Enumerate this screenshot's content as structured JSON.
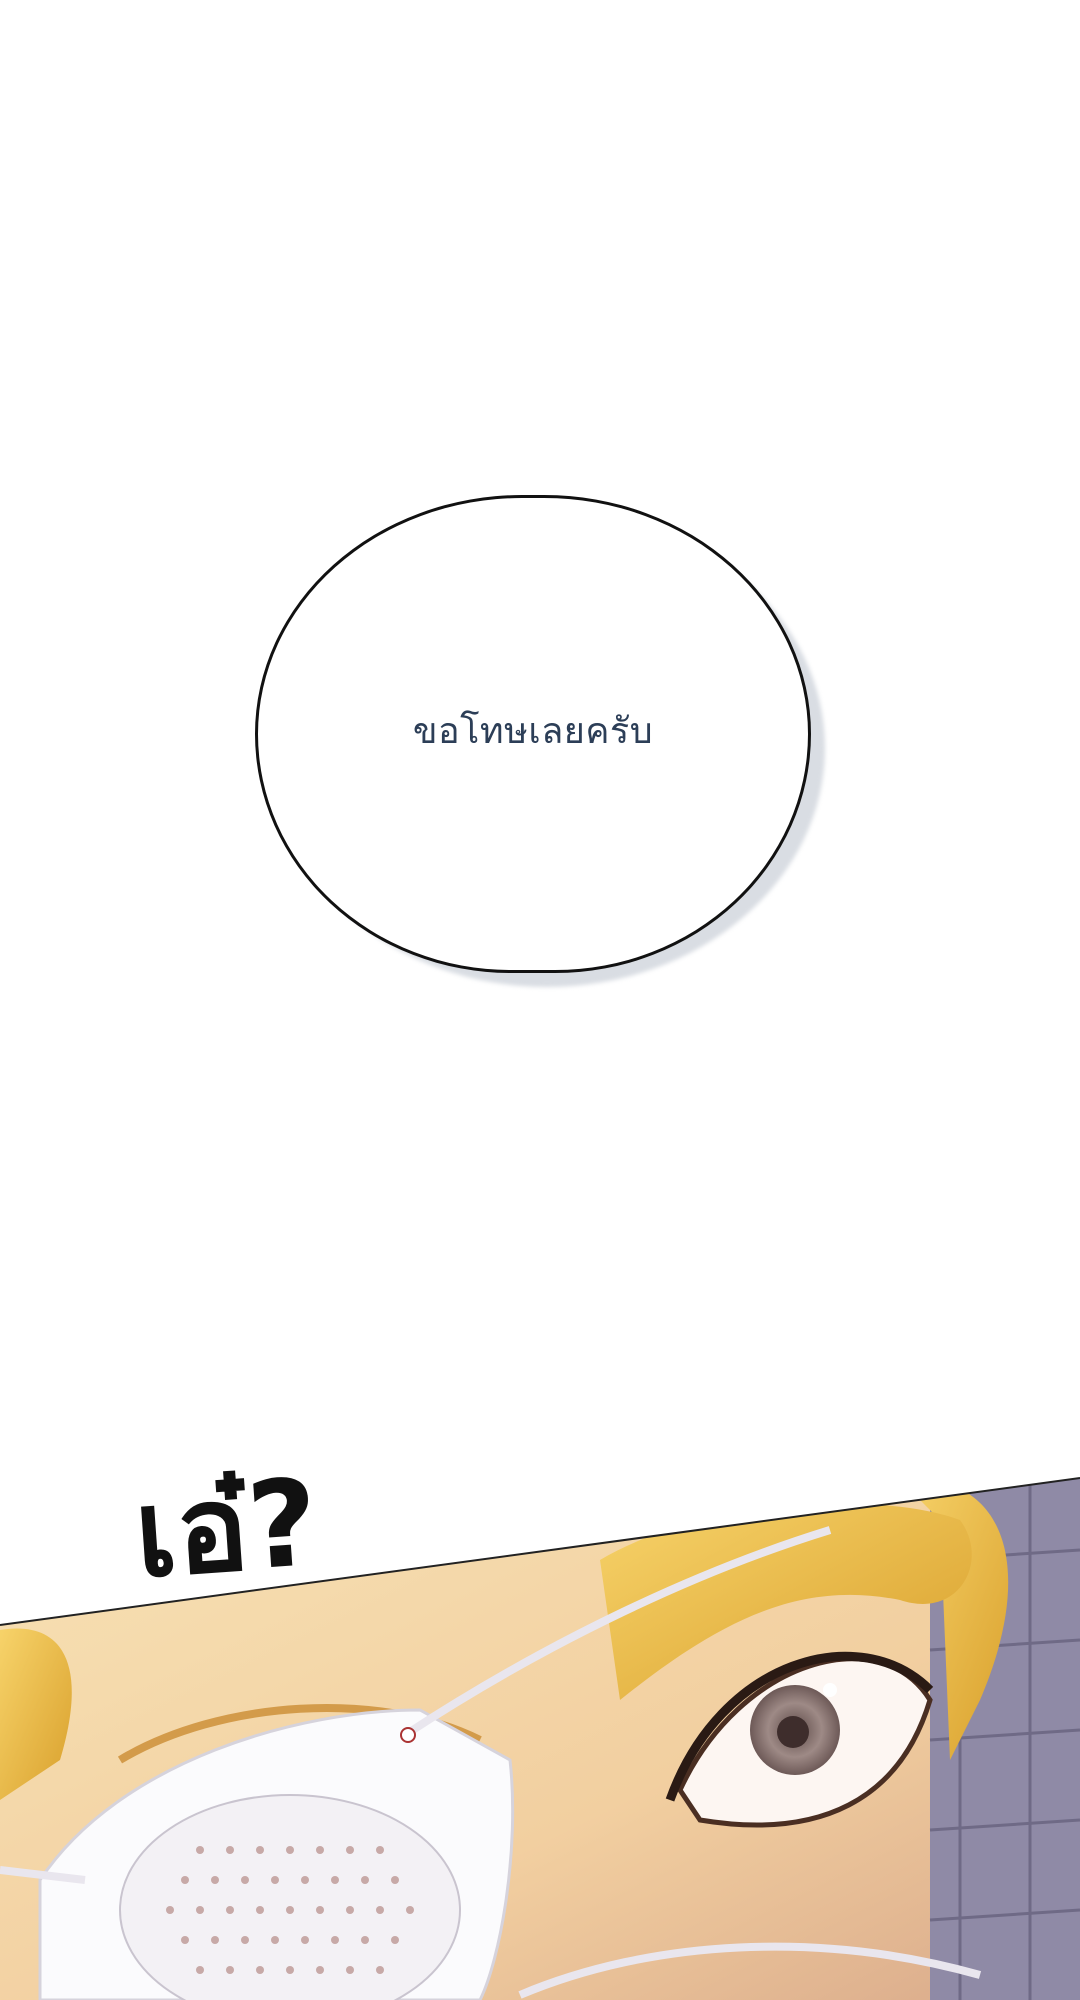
{
  "speech_bubble": {
    "text": "ขอโทษเลยครับ"
  },
  "sound_effect": {
    "text": "เอ๋?"
  },
  "colors": {
    "background": "#ffffff",
    "bubble_text": "#2c3e57",
    "hair": "#f0c24a",
    "skin": "#f5d9a8",
    "mask": "#ffffff",
    "wall": "#8f8aa6"
  }
}
